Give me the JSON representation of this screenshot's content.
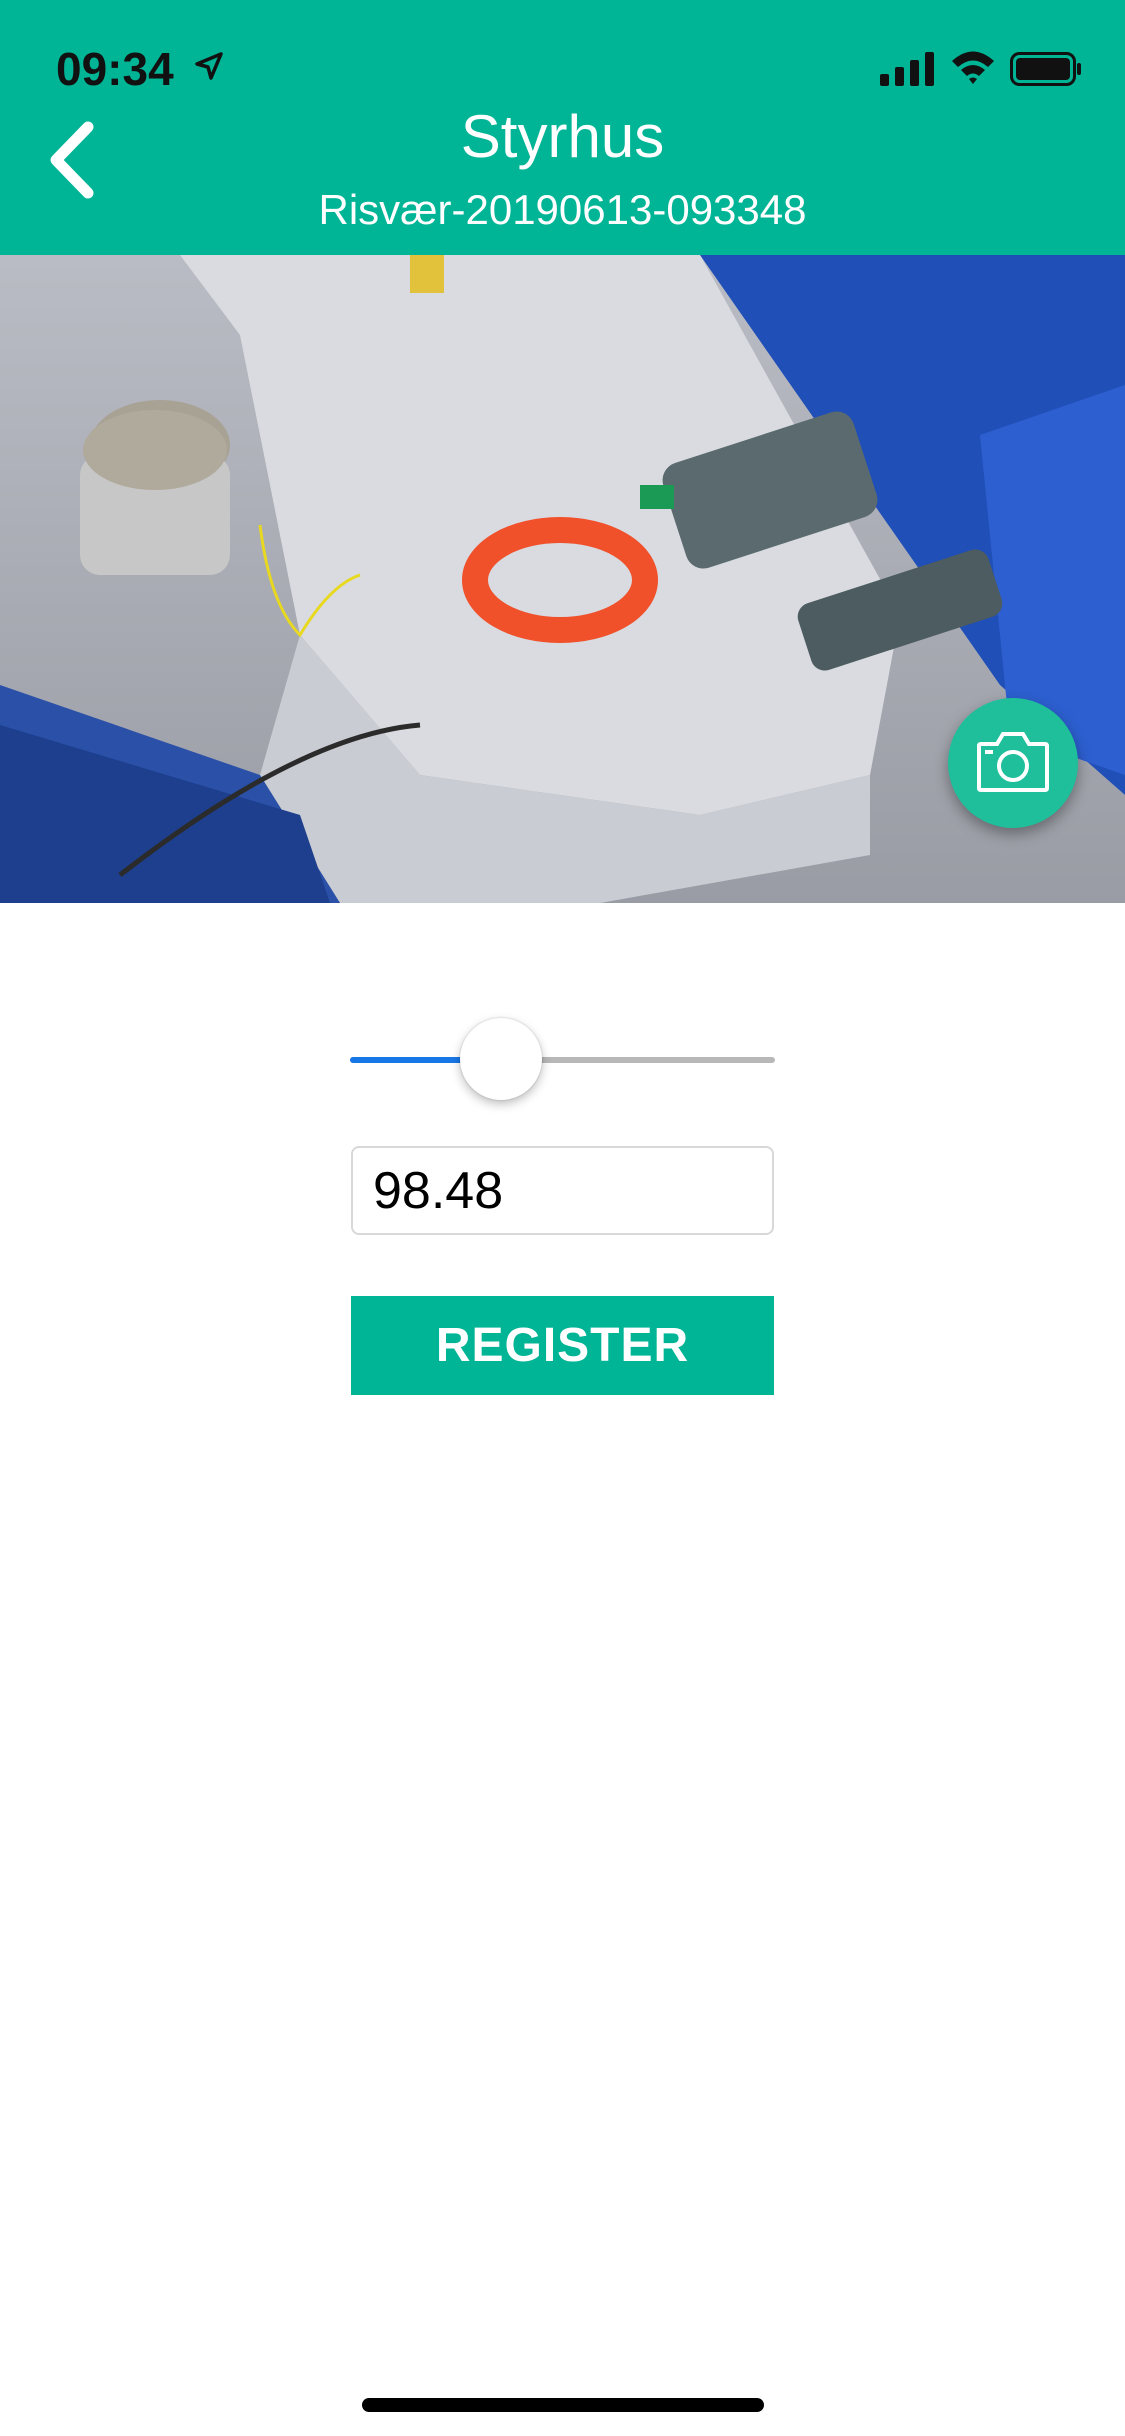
{
  "status_bar": {
    "time": "09:34",
    "icons": [
      "location-arrow-icon",
      "signal-icon",
      "wifi-icon",
      "battery-icon"
    ]
  },
  "header": {
    "title": "Styrhus",
    "subtitle": "Risvær-20190613-093348",
    "back_icon": "chevron-left-icon",
    "background_color": "#00b496"
  },
  "photo": {
    "camera_icon": "camera-icon"
  },
  "slider": {
    "value_fraction": 0.32,
    "fill_color": "#1877e6"
  },
  "input": {
    "value": "98.48"
  },
  "register": {
    "label": "REGISTER"
  }
}
